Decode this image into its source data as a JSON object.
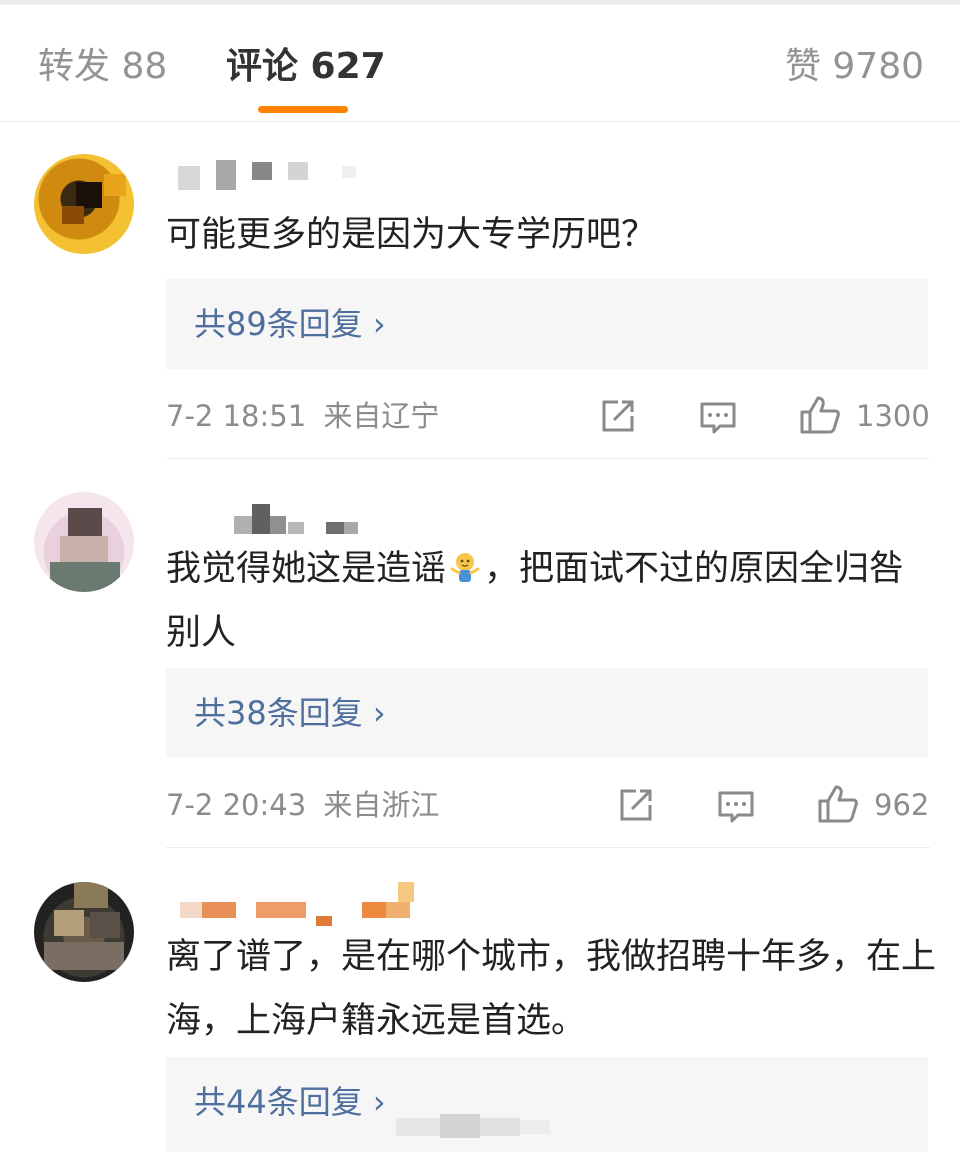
{
  "tabs": {
    "repost": "转发 88",
    "comments": "评论 627",
    "likes": "赞 9780"
  },
  "colors": {
    "accent": "#ff8200",
    "link": "#4f6f9e",
    "meta": "#8c8c8c"
  },
  "comments": [
    {
      "text": "可能更多的是因为大专学历吧？",
      "replies": "共89条回复 ›",
      "time": "7-2 18:51",
      "location": "来自辽宁",
      "likes": "1300"
    },
    {
      "text_a": "我觉得她这是造谣",
      "emoji": "shrug-emoji",
      "text_b": "，把面试不过的原因全归咎别人",
      "replies": "共38条回复 ›",
      "time": "7-2 20:43",
      "location": "来自浙江",
      "likes": "962"
    },
    {
      "text": "离了谱了，是在哪个城市，我做招聘十年多，在上海，上海户籍永远是首选。",
      "replies": "共44条回复 ›"
    }
  ],
  "icons": [
    "repost-icon",
    "comment-icon",
    "like-icon",
    "chevron-right-icon"
  ]
}
